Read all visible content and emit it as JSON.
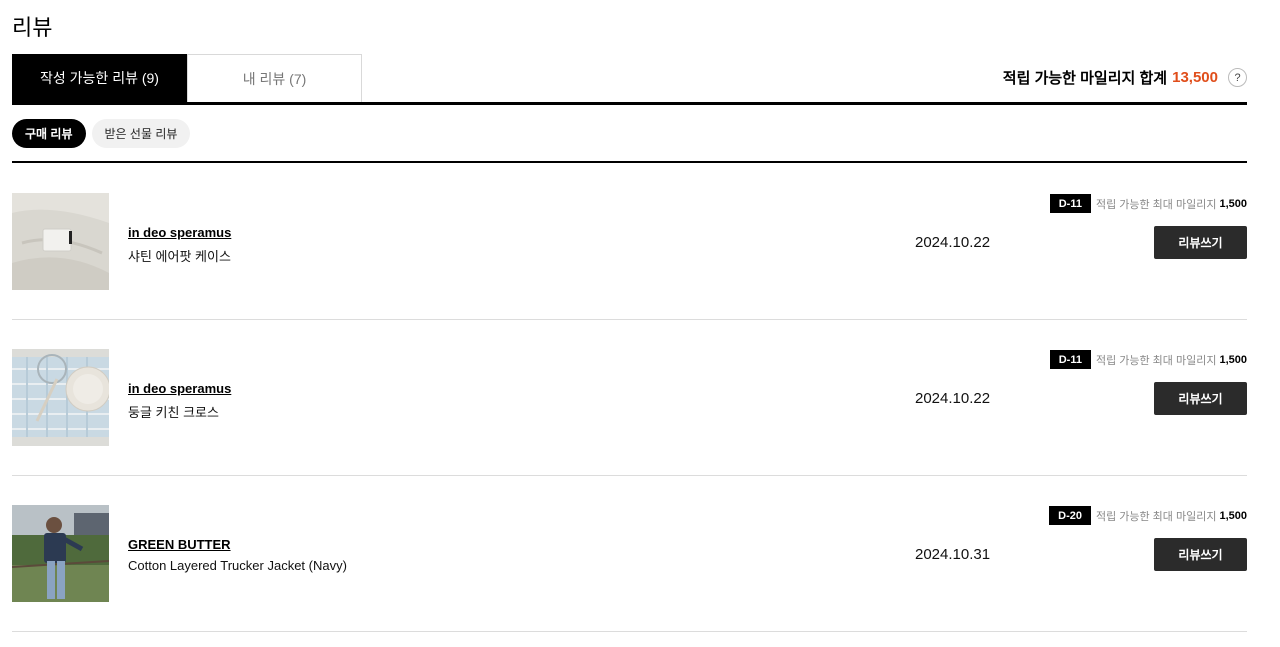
{
  "page": {
    "title": "리뷰"
  },
  "tabs": [
    {
      "label": "작성 가능한 리뷰 (9)"
    },
    {
      "label": "내 리뷰 (7)"
    }
  ],
  "mileage": {
    "label": "적립 가능한 마일리지 합계",
    "total": "13,500",
    "help_icon": "question-icon",
    "accent_color": "#e04e1b"
  },
  "subtabs": [
    {
      "label": "구매 리뷰"
    },
    {
      "label": "받은 선물 리뷰"
    }
  ],
  "items": [
    {
      "brand": "in deo speramus",
      "product": "샤틴 에어팟 케이스",
      "date": "2024.10.22",
      "dday": "D-11",
      "mileage_label": "적립 가능한 최대 마일리지",
      "mileage": "1,500",
      "button": "리뷰쓰기"
    },
    {
      "brand": "in deo speramus",
      "product": "둥글 키친 크로스",
      "date": "2024.10.22",
      "dday": "D-11",
      "mileage_label": "적립 가능한 최대 마일리지",
      "mileage": "1,500",
      "button": "리뷰쓰기"
    },
    {
      "brand": "GREEN BUTTER",
      "product": "Cotton Layered Trucker Jacket (Navy)",
      "date": "2024.10.31",
      "dday": "D-20",
      "mileage_label": "적립 가능한 최대 마일리지",
      "mileage": "1,500",
      "button": "리뷰쓰기"
    }
  ]
}
